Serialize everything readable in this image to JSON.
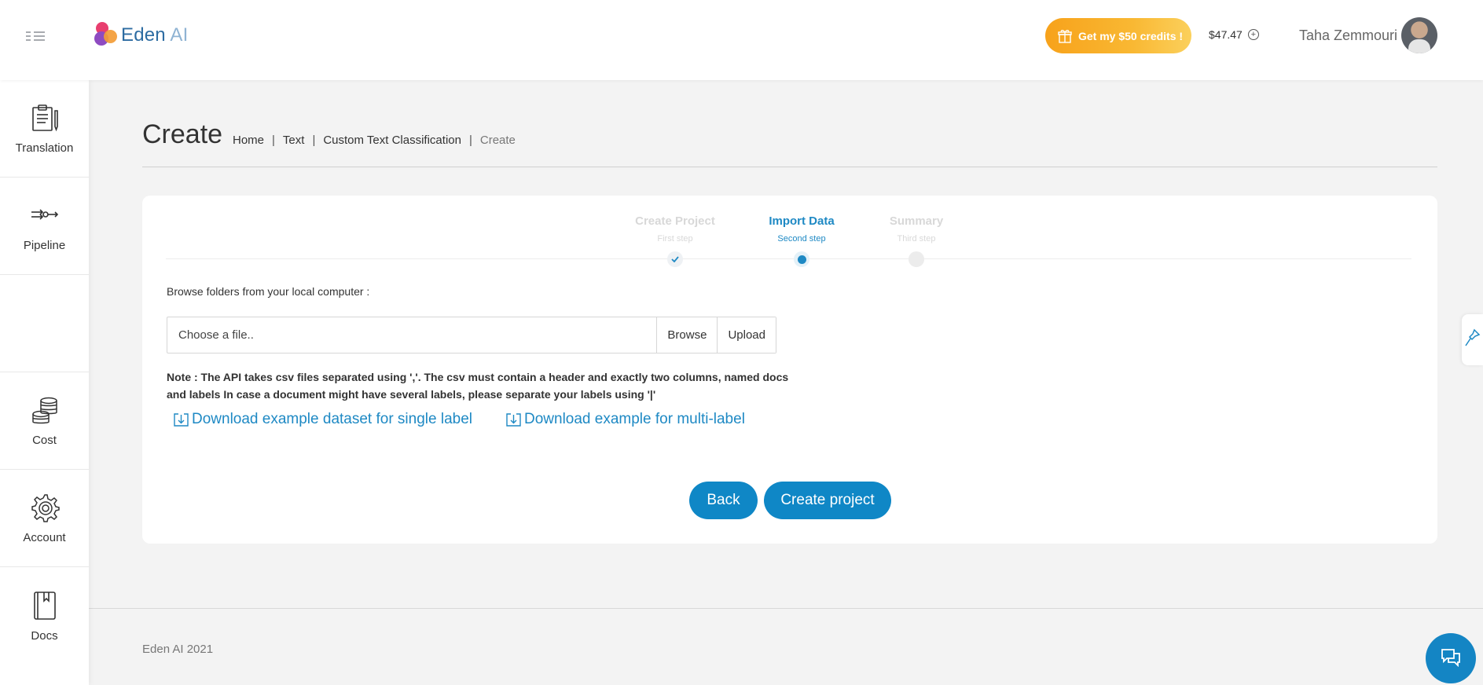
{
  "header": {
    "logo_text": "Eden",
    "logo_text_ai": "AI",
    "credits_button": "Get my $50 credits !",
    "balance": "$47.47",
    "user_name": "Taha Zemmouri"
  },
  "sidebar": {
    "items": [
      {
        "label": "Translation",
        "icon": "clipboard-pencil-icon"
      },
      {
        "label": "Pipeline",
        "icon": "pipeline-arrows-icon"
      },
      {
        "label": "",
        "icon": ""
      },
      {
        "label": "Cost",
        "icon": "coins-stack-icon"
      },
      {
        "label": "Account",
        "icon": "gear-icon"
      },
      {
        "label": "Docs",
        "icon": "book-icon"
      }
    ]
  },
  "page": {
    "title": "Create",
    "breadcrumb": [
      "Home",
      "Text",
      "Custom Text Classification",
      "Create"
    ]
  },
  "steps": [
    {
      "title": "Create Project",
      "subtitle": "First step",
      "state": "done"
    },
    {
      "title": "Import Data",
      "subtitle": "Second step",
      "state": "active"
    },
    {
      "title": "Summary",
      "subtitle": "Third step",
      "state": "pending"
    }
  ],
  "upload": {
    "label": "Browse folders from your local computer :",
    "placeholder": "Choose a file..",
    "browse_button": "Browse",
    "upload_button": "Upload",
    "note": "Note : The API takes csv files separated using ','. The csv must contain a header and exactly two columns, named docs and labels In case a document might have several labels, please separate your labels using '|'",
    "download_single": "Download example dataset for single label",
    "download_multi": "Download example for multi-label"
  },
  "actions": {
    "back": "Back",
    "create": "Create project"
  },
  "footer": {
    "text": "Eden AI 2021"
  },
  "colors": {
    "primary": "#0f87c6",
    "accent_orange": "#f7a21b"
  }
}
